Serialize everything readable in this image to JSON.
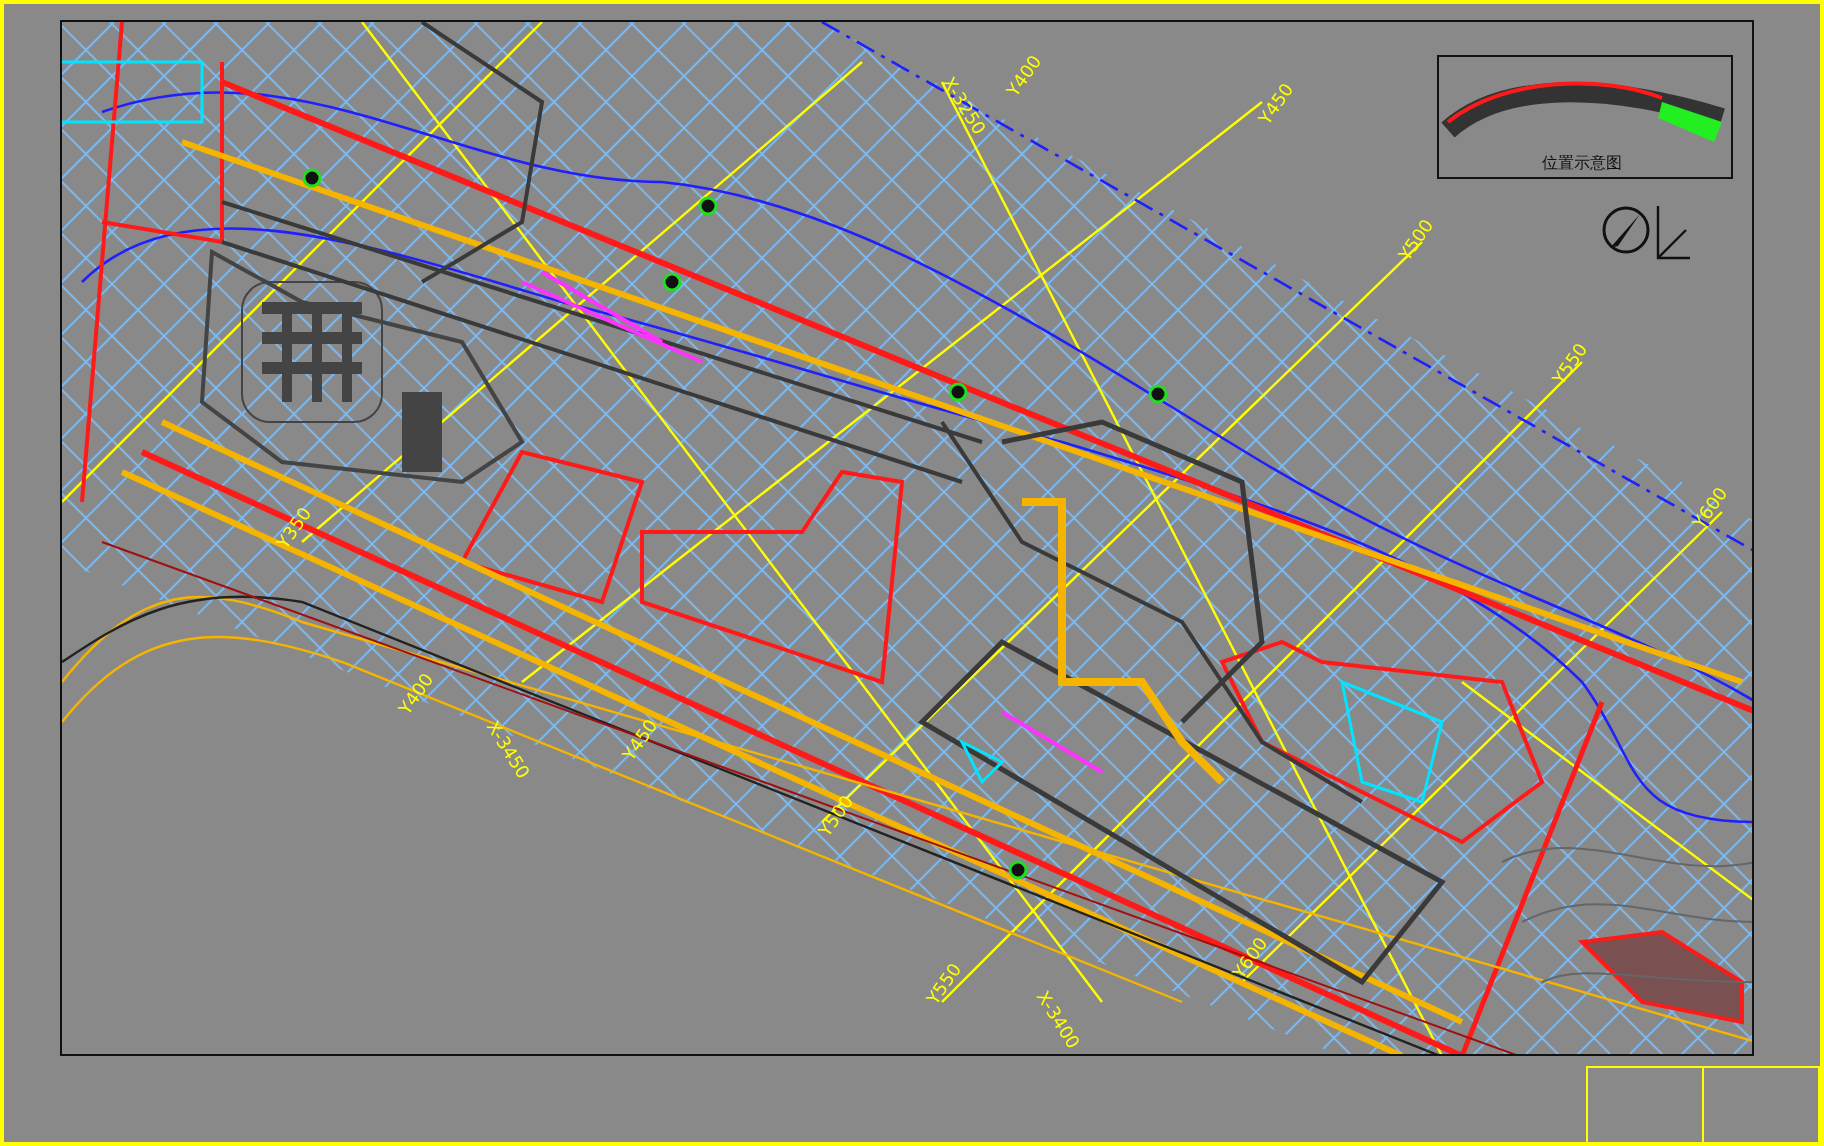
{
  "drawing": {
    "grid_labels": [
      {
        "text": "X-3250"
      },
      {
        "text": "Y400"
      },
      {
        "text": "Y450"
      },
      {
        "text": "Y500"
      },
      {
        "text": "Y550"
      },
      {
        "text": "Y600"
      },
      {
        "text": "Y350"
      },
      {
        "text": "Y400"
      },
      {
        "text": "X-3450"
      },
      {
        "text": "Y450"
      },
      {
        "text": "Y500"
      },
      {
        "text": "Y550"
      },
      {
        "text": "X-3400"
      },
      {
        "text": "Y600"
      }
    ],
    "inset": {
      "title": "位置示意图"
    }
  }
}
